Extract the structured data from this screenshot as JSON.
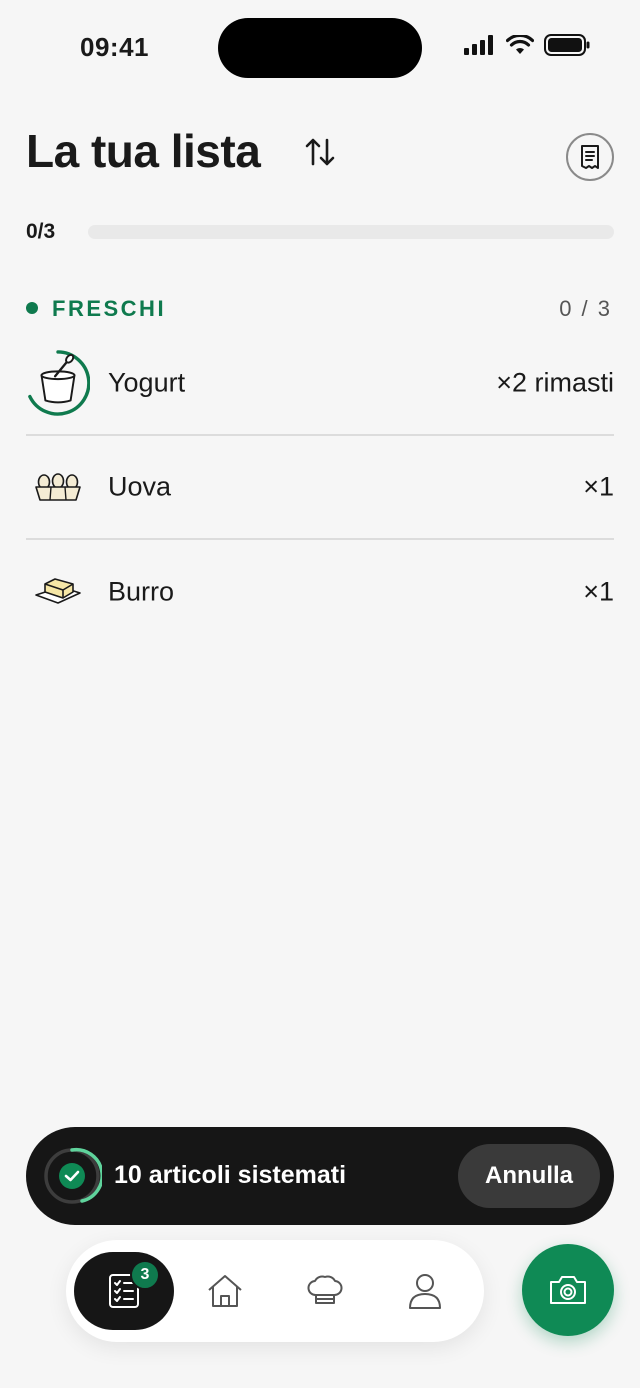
{
  "status_bar": {
    "time": "09:41"
  },
  "header": {
    "title": "La tua lista"
  },
  "progress": {
    "label": "0/3",
    "fraction": 0
  },
  "section": {
    "title": "FRESCHI",
    "count": "0 / 3"
  },
  "items": [
    {
      "name": "Yogurt",
      "qty": "×2 rimasti",
      "icon": "yogurt-icon"
    },
    {
      "name": "Uova",
      "qty": "×1",
      "icon": "eggs-icon"
    },
    {
      "name": "Burro",
      "qty": "×1",
      "icon": "butter-icon"
    }
  ],
  "toast": {
    "message": "10 articoli sistemati",
    "undo_label": "Annulla"
  },
  "nav": {
    "badge": "3",
    "items": [
      "list-icon",
      "home-icon",
      "chef-hat-icon",
      "profile-icon"
    ]
  },
  "colors": {
    "accent": "#0f7a4e",
    "toast_bg": "#161616",
    "background": "#f6f6f6"
  }
}
